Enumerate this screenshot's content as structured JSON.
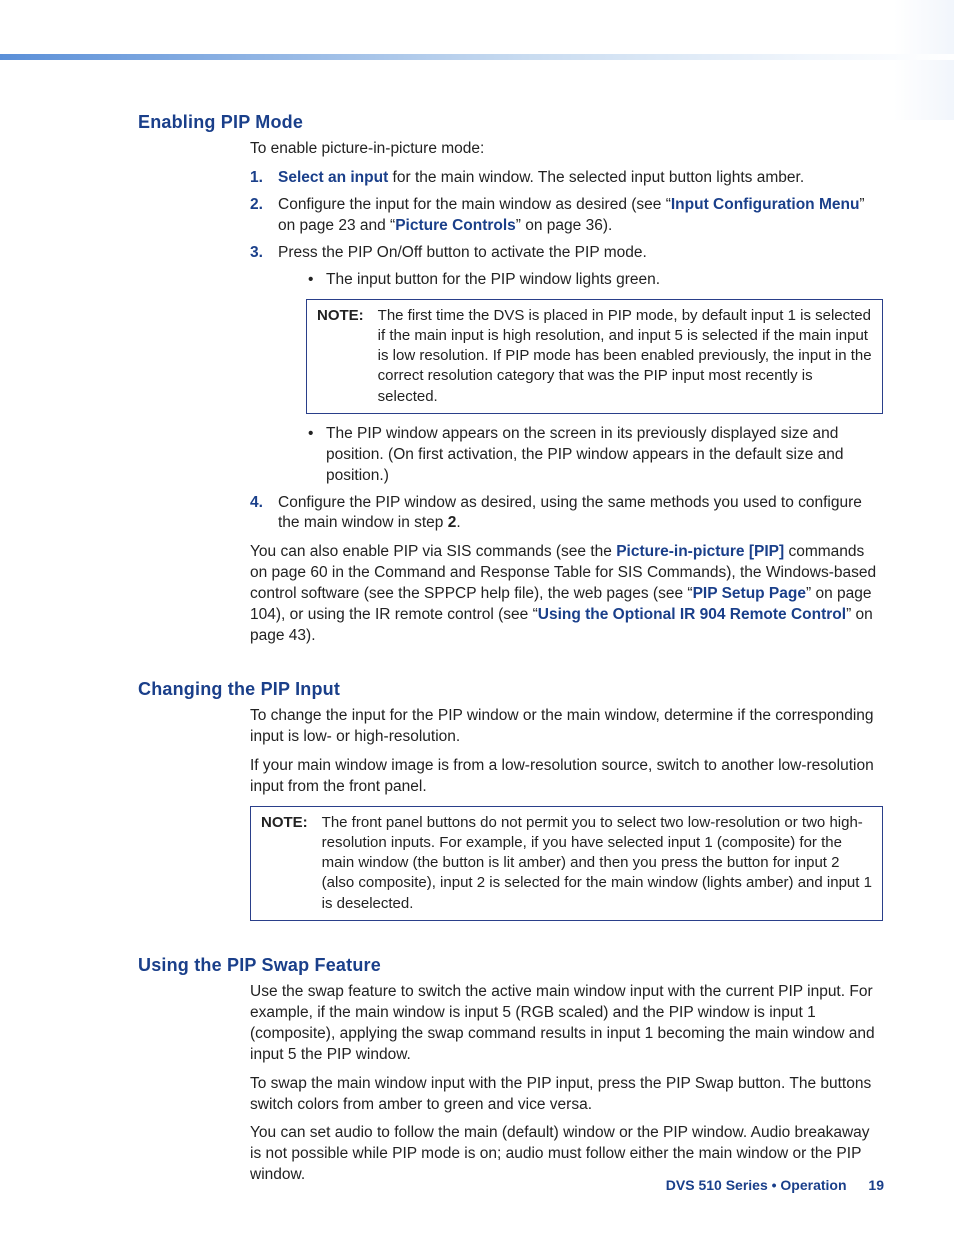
{
  "section1": {
    "heading": "Enabling PIP Mode",
    "intro": "To enable picture-in-picture mode:",
    "step1_num": "1.",
    "step1_link": "Select an input",
    "step1_rest": " for the main window. The selected input button lights amber.",
    "step2_num": "2.",
    "step2_a": "Configure the input for the main window as desired (see “",
    "step2_link1": "Input Configuration Menu",
    "step2_b": "” on page 23 and “",
    "step2_link2": "Picture Controls",
    "step2_c": "” on page 36).",
    "step3_num": "3.",
    "step3_text": "Press the PIP On/Off button to activate the PIP mode.",
    "step3_b1": "The input button for the PIP window lights green.",
    "note1_label": "NOTE:",
    "note1_text": "The first time the DVS is placed in PIP mode, by default input 1 is selected if the main input is high resolution, and input 5 is selected if the main input is low resolution. If PIP mode has been enabled previously, the input in the correct resolution category that was the PIP input most recently is selected.",
    "step3_b2": "The PIP window appears on the screen in its previously displayed size and position. (On first activation, the PIP window appears in the default size and position.)",
    "step4_num": "4.",
    "step4_a": "Configure the PIP window as desired, using the same methods you used to configure the main window in step ",
    "step4_bold": "2",
    "step4_b": ".",
    "para_a": "You can also enable PIP via SIS commands (see the ",
    "para_link1": "Picture-in-picture [PIP]",
    "para_b": " commands on page 60 in the Command and Response Table for SIS Commands), the Windows-based control software (see the SPPCP help file), the web pages (see “",
    "para_link2": "PIP Setup Page",
    "para_c": "” on page 104), or using the IR remote control (see “",
    "para_link3": "Using the Optional IR 904 Remote Control",
    "para_d": "” on page 43)."
  },
  "section2": {
    "heading": "Changing the PIP Input",
    "p1": "To change the input for the PIP window or the main window, determine if the corresponding input is low- or high-resolution.",
    "p2": "If your main window image is from a low-resolution source, switch to another low-resolution input from the front panel.",
    "note_label": "NOTE:",
    "note_text": "The front panel buttons do not permit you to select two low-resolution or two high-resolution inputs. For example, if you have selected input 1 (composite) for the main window (the button is lit amber) and then you press the button for input 2 (also composite), input 2 is selected for the main window (lights amber) and input 1 is deselected."
  },
  "section3": {
    "heading": "Using the PIP Swap Feature",
    "p1": "Use the swap feature to switch the active main window input with the current PIP input. For example, if the main window is input 5 (RGB scaled) and the PIP window is input 1 (composite), applying the swap command results in input 1 becoming the main window and input 5 the PIP window.",
    "p2": "To swap the main window input with the PIP input, press the PIP Swap button. The buttons switch colors from amber to green and vice versa.",
    "p3": "You can set audio to follow the main (default) window or the PIP window. Audio breakaway is not possible while PIP mode is on; audio must follow either the main window or the PIP window."
  },
  "footer": {
    "text": "DVS 510 Series • Operation",
    "page": "19"
  }
}
